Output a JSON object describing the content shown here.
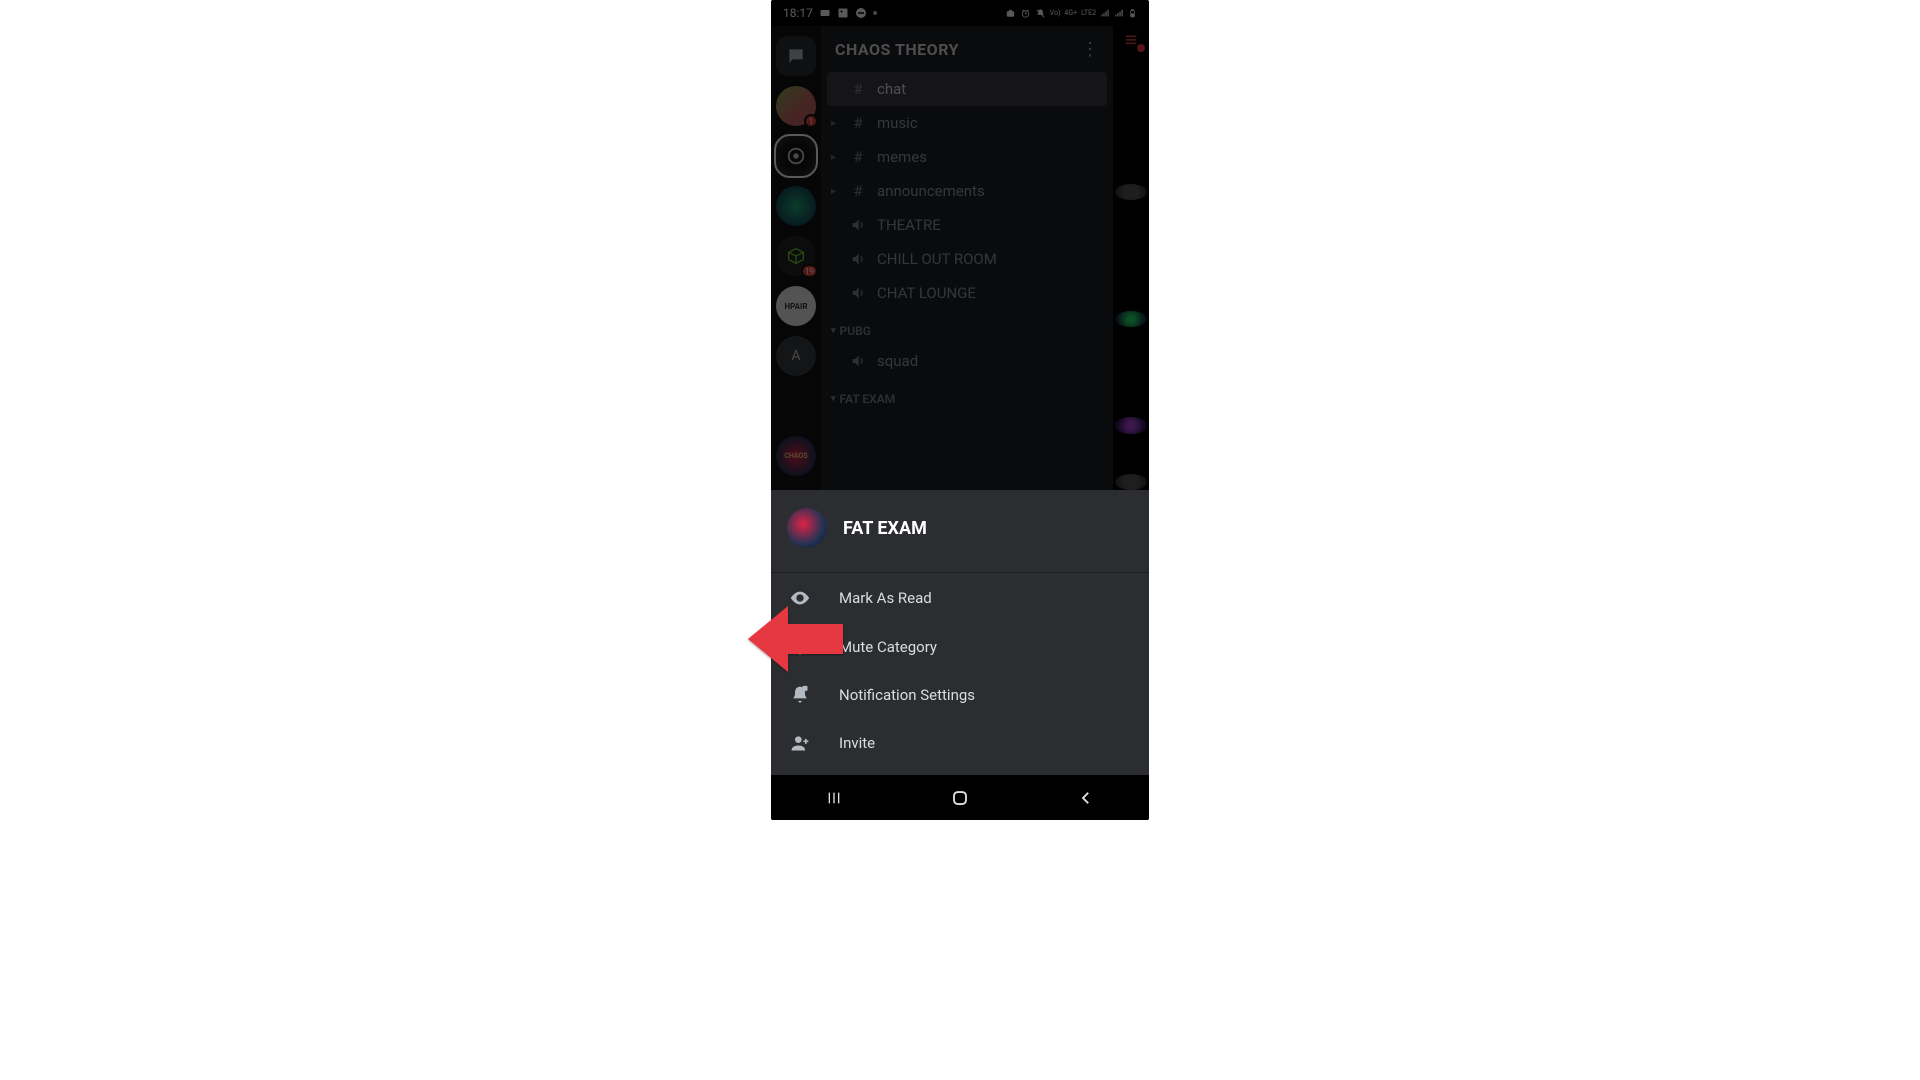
{
  "statusbar": {
    "time": "18:17",
    "net": "LTE2",
    "net2": "4G+",
    "vo": "Vo)"
  },
  "server": {
    "title": "CHAOS THEORY"
  },
  "server_rail": {
    "items": [
      {
        "kind": "dm"
      },
      {
        "kind": "server",
        "badge": "1"
      },
      {
        "kind": "server",
        "selected": true
      },
      {
        "kind": "server",
        "label": ""
      },
      {
        "kind": "server",
        "badge": "19"
      },
      {
        "kind": "server",
        "label": "HPAIR"
      },
      {
        "kind": "server",
        "label": "A"
      },
      {
        "kind": "server",
        "label": ""
      },
      {
        "kind": "server",
        "label": "CHAOS"
      }
    ]
  },
  "channels": [
    {
      "type": "text",
      "name": "chat",
      "selected": true,
      "thread": false
    },
    {
      "type": "text",
      "name": "music",
      "thread": true
    },
    {
      "type": "text",
      "name": "memes",
      "thread": true
    },
    {
      "type": "text",
      "name": "announcements",
      "thread": true
    },
    {
      "type": "voice",
      "name": "THEATRE"
    },
    {
      "type": "voice",
      "name": "CHILL OUT ROOM"
    },
    {
      "type": "voice",
      "name": "CHAT LOUNGE"
    }
  ],
  "categories": [
    {
      "name": "PUBG",
      "channels": [
        {
          "type": "voice",
          "name": "squad"
        }
      ]
    },
    {
      "name": "FAT EXAM",
      "channels": []
    }
  ],
  "sheet": {
    "title": "FAT EXAM",
    "items": [
      {
        "icon": "eye",
        "label": "Mark As Read"
      },
      {
        "icon": "bell",
        "label": "Mute Category"
      },
      {
        "icon": "bell-badge",
        "label": "Notification Settings"
      },
      {
        "icon": "person-add",
        "label": "Invite"
      }
    ]
  }
}
